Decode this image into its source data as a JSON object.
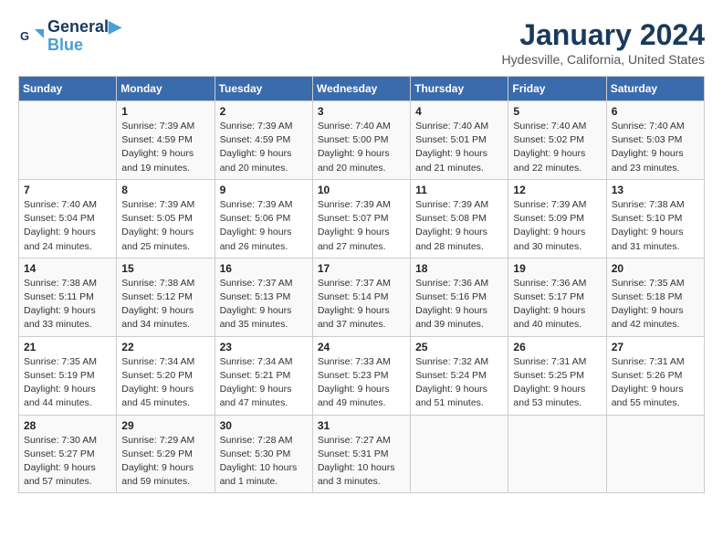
{
  "logo": {
    "line1": "General",
    "line2": "Blue"
  },
  "title": "January 2024",
  "subtitle": "Hydesville, California, United States",
  "days_of_week": [
    "Sunday",
    "Monday",
    "Tuesday",
    "Wednesday",
    "Thursday",
    "Friday",
    "Saturday"
  ],
  "weeks": [
    [
      {
        "num": "",
        "sunrise": "",
        "sunset": "",
        "daylight": ""
      },
      {
        "num": "1",
        "sunrise": "Sunrise: 7:39 AM",
        "sunset": "Sunset: 4:59 PM",
        "daylight": "Daylight: 9 hours and 19 minutes."
      },
      {
        "num": "2",
        "sunrise": "Sunrise: 7:39 AM",
        "sunset": "Sunset: 4:59 PM",
        "daylight": "Daylight: 9 hours and 20 minutes."
      },
      {
        "num": "3",
        "sunrise": "Sunrise: 7:40 AM",
        "sunset": "Sunset: 5:00 PM",
        "daylight": "Daylight: 9 hours and 20 minutes."
      },
      {
        "num": "4",
        "sunrise": "Sunrise: 7:40 AM",
        "sunset": "Sunset: 5:01 PM",
        "daylight": "Daylight: 9 hours and 21 minutes."
      },
      {
        "num": "5",
        "sunrise": "Sunrise: 7:40 AM",
        "sunset": "Sunset: 5:02 PM",
        "daylight": "Daylight: 9 hours and 22 minutes."
      },
      {
        "num": "6",
        "sunrise": "Sunrise: 7:40 AM",
        "sunset": "Sunset: 5:03 PM",
        "daylight": "Daylight: 9 hours and 23 minutes."
      }
    ],
    [
      {
        "num": "7",
        "sunrise": "Sunrise: 7:40 AM",
        "sunset": "Sunset: 5:04 PM",
        "daylight": "Daylight: 9 hours and 24 minutes."
      },
      {
        "num": "8",
        "sunrise": "Sunrise: 7:39 AM",
        "sunset": "Sunset: 5:05 PM",
        "daylight": "Daylight: 9 hours and 25 minutes."
      },
      {
        "num": "9",
        "sunrise": "Sunrise: 7:39 AM",
        "sunset": "Sunset: 5:06 PM",
        "daylight": "Daylight: 9 hours and 26 minutes."
      },
      {
        "num": "10",
        "sunrise": "Sunrise: 7:39 AM",
        "sunset": "Sunset: 5:07 PM",
        "daylight": "Daylight: 9 hours and 27 minutes."
      },
      {
        "num": "11",
        "sunrise": "Sunrise: 7:39 AM",
        "sunset": "Sunset: 5:08 PM",
        "daylight": "Daylight: 9 hours and 28 minutes."
      },
      {
        "num": "12",
        "sunrise": "Sunrise: 7:39 AM",
        "sunset": "Sunset: 5:09 PM",
        "daylight": "Daylight: 9 hours and 30 minutes."
      },
      {
        "num": "13",
        "sunrise": "Sunrise: 7:38 AM",
        "sunset": "Sunset: 5:10 PM",
        "daylight": "Daylight: 9 hours and 31 minutes."
      }
    ],
    [
      {
        "num": "14",
        "sunrise": "Sunrise: 7:38 AM",
        "sunset": "Sunset: 5:11 PM",
        "daylight": "Daylight: 9 hours and 33 minutes."
      },
      {
        "num": "15",
        "sunrise": "Sunrise: 7:38 AM",
        "sunset": "Sunset: 5:12 PM",
        "daylight": "Daylight: 9 hours and 34 minutes."
      },
      {
        "num": "16",
        "sunrise": "Sunrise: 7:37 AM",
        "sunset": "Sunset: 5:13 PM",
        "daylight": "Daylight: 9 hours and 35 minutes."
      },
      {
        "num": "17",
        "sunrise": "Sunrise: 7:37 AM",
        "sunset": "Sunset: 5:14 PM",
        "daylight": "Daylight: 9 hours and 37 minutes."
      },
      {
        "num": "18",
        "sunrise": "Sunrise: 7:36 AM",
        "sunset": "Sunset: 5:16 PM",
        "daylight": "Daylight: 9 hours and 39 minutes."
      },
      {
        "num": "19",
        "sunrise": "Sunrise: 7:36 AM",
        "sunset": "Sunset: 5:17 PM",
        "daylight": "Daylight: 9 hours and 40 minutes."
      },
      {
        "num": "20",
        "sunrise": "Sunrise: 7:35 AM",
        "sunset": "Sunset: 5:18 PM",
        "daylight": "Daylight: 9 hours and 42 minutes."
      }
    ],
    [
      {
        "num": "21",
        "sunrise": "Sunrise: 7:35 AM",
        "sunset": "Sunset: 5:19 PM",
        "daylight": "Daylight: 9 hours and 44 minutes."
      },
      {
        "num": "22",
        "sunrise": "Sunrise: 7:34 AM",
        "sunset": "Sunset: 5:20 PM",
        "daylight": "Daylight: 9 hours and 45 minutes."
      },
      {
        "num": "23",
        "sunrise": "Sunrise: 7:34 AM",
        "sunset": "Sunset: 5:21 PM",
        "daylight": "Daylight: 9 hours and 47 minutes."
      },
      {
        "num": "24",
        "sunrise": "Sunrise: 7:33 AM",
        "sunset": "Sunset: 5:23 PM",
        "daylight": "Daylight: 9 hours and 49 minutes."
      },
      {
        "num": "25",
        "sunrise": "Sunrise: 7:32 AM",
        "sunset": "Sunset: 5:24 PM",
        "daylight": "Daylight: 9 hours and 51 minutes."
      },
      {
        "num": "26",
        "sunrise": "Sunrise: 7:31 AM",
        "sunset": "Sunset: 5:25 PM",
        "daylight": "Daylight: 9 hours and 53 minutes."
      },
      {
        "num": "27",
        "sunrise": "Sunrise: 7:31 AM",
        "sunset": "Sunset: 5:26 PM",
        "daylight": "Daylight: 9 hours and 55 minutes."
      }
    ],
    [
      {
        "num": "28",
        "sunrise": "Sunrise: 7:30 AM",
        "sunset": "Sunset: 5:27 PM",
        "daylight": "Daylight: 9 hours and 57 minutes."
      },
      {
        "num": "29",
        "sunrise": "Sunrise: 7:29 AM",
        "sunset": "Sunset: 5:29 PM",
        "daylight": "Daylight: 9 hours and 59 minutes."
      },
      {
        "num": "30",
        "sunrise": "Sunrise: 7:28 AM",
        "sunset": "Sunset: 5:30 PM",
        "daylight": "Daylight: 10 hours and 1 minute."
      },
      {
        "num": "31",
        "sunrise": "Sunrise: 7:27 AM",
        "sunset": "Sunset: 5:31 PM",
        "daylight": "Daylight: 10 hours and 3 minutes."
      },
      {
        "num": "",
        "sunrise": "",
        "sunset": "",
        "daylight": ""
      },
      {
        "num": "",
        "sunrise": "",
        "sunset": "",
        "daylight": ""
      },
      {
        "num": "",
        "sunrise": "",
        "sunset": "",
        "daylight": ""
      }
    ]
  ]
}
